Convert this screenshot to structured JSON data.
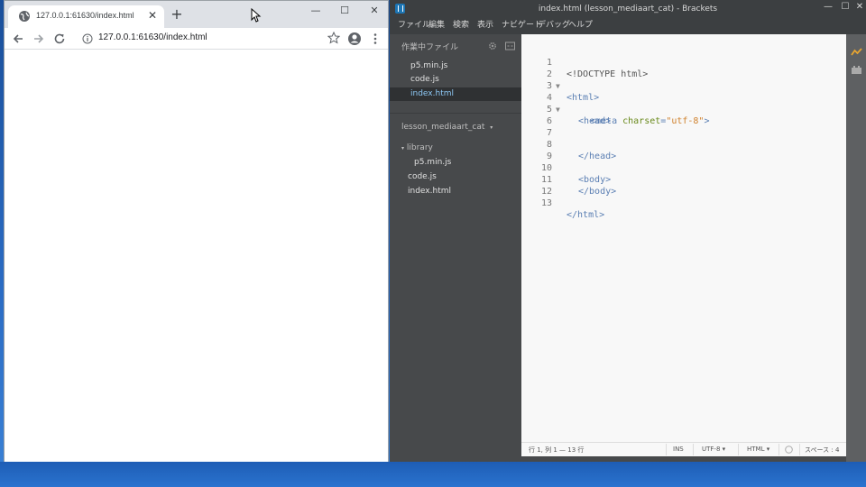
{
  "chrome": {
    "tab_title": "127.0.0.1:61630/index.html",
    "url": "127.0.0.1:61630/index.html"
  },
  "brackets": {
    "window_title": "index.html (lesson_mediaart_cat) - Brackets",
    "menus": [
      "ファイル",
      "編集",
      "検索",
      "表示",
      "ナビゲート",
      "デバッグ",
      "ヘルプ"
    ],
    "working_files_header": "作業中ファイル",
    "working_files": [
      "p5.min.js",
      "code.js",
      "index.html"
    ],
    "active_file": "index.html",
    "project_name": "lesson_mediaart_cat",
    "tree": {
      "folder": "library",
      "folder_children": [
        "p5.min.js"
      ],
      "files": [
        "code.js",
        "index.html"
      ]
    },
    "code_lines": [
      {
        "n": "1",
        "text": "<!DOCTYPE html>"
      },
      {
        "n": "2",
        "text": "<html>"
      },
      {
        "n": "3",
        "text": ""
      },
      {
        "n": "4",
        "text": "<head>"
      },
      {
        "n": "5",
        "text": "<meta charset=\"utf-8\">"
      },
      {
        "n": "6",
        "text": ""
      },
      {
        "n": "7",
        "text": ""
      },
      {
        "n": "8",
        "text": "</head>"
      },
      {
        "n": "9",
        "text": ""
      },
      {
        "n": "10",
        "text": "<body>"
      },
      {
        "n": "11",
        "text": "</body>"
      },
      {
        "n": "12",
        "text": ""
      },
      {
        "n": "13",
        "text": "</html>"
      }
    ],
    "status": {
      "position": "行 1, 列 1 — 13 行",
      "mode": "INS",
      "encoding": "UTF-8",
      "language": "HTML",
      "indent": "スペース : 4"
    }
  },
  "colors": {
    "editor_bg": "#f8f8f8",
    "sidebar_bg": "#47494b",
    "active_file": "#8dc8f5",
    "tag": "#5b7fb3",
    "attr": "#6a8a1c",
    "string": "#d0822e"
  }
}
